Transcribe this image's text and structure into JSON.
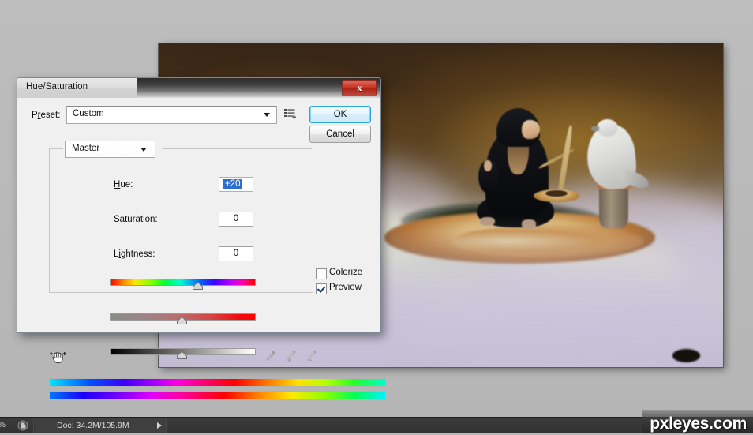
{
  "dialog": {
    "title": "Hue/Saturation",
    "close_label": "x",
    "preset": {
      "label": "Preset:",
      "value": "Custom",
      "menu_icon": "preset-menu-icon"
    },
    "buttons": {
      "ok": "OK",
      "cancel": "Cancel"
    },
    "channel": {
      "value": "Master"
    },
    "sliders": [
      {
        "label": "Hue:",
        "value": "+20",
        "selected": true,
        "thumb_pct": 61
      },
      {
        "label": "Saturation:",
        "value": "0",
        "selected": false,
        "thumb_pct": 50
      },
      {
        "label": "Lightness:",
        "value": "0",
        "selected": false,
        "thumb_pct": 50
      }
    ],
    "checkboxes": [
      {
        "label": "Colorize",
        "checked": false
      },
      {
        "label": "Preview",
        "checked": true
      }
    ],
    "tools": {
      "scrub_icon": "scrubby-hand-icon",
      "eyedroppers": [
        "eyedropper-icon",
        "eyedropper-add-icon",
        "eyedropper-subtract-icon"
      ]
    }
  },
  "statusbar": {
    "zoom_unit": "%",
    "doc": "Doc: 34.2M/105.9M"
  },
  "watermark": "pxleyes.com",
  "colors": {
    "accent_ok": "#2ca7e0",
    "close_red": "#c93a2c",
    "dialog_bg": "#f0f0f0",
    "selection_blue": "#2d6fd0"
  }
}
